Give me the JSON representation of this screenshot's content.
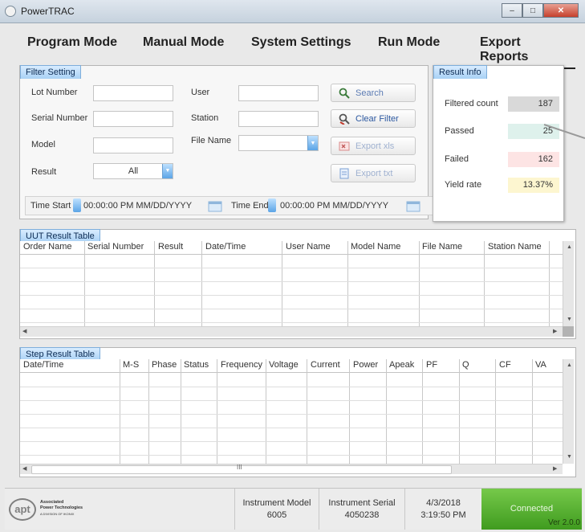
{
  "window": {
    "title": "PowerTRAC"
  },
  "nav": {
    "tabs": [
      "Program Mode",
      "Manual Mode",
      "System Settings",
      "Run Mode",
      "Export Reports"
    ],
    "active": "Export Reports"
  },
  "filter": {
    "title": "Filter Setting",
    "labels": {
      "lot_number": "Lot Number",
      "serial_number": "Serial Number",
      "model": "Model",
      "result": "Result",
      "user": "User",
      "station": "Station",
      "file_name": "File Name"
    },
    "values": {
      "lot_number": "",
      "serial_number": "",
      "model": "",
      "result": "All",
      "user": "",
      "station": "",
      "file_name": ""
    },
    "buttons": {
      "search": "Search",
      "clear_filter": "Clear Filter",
      "export_xls": "Export xls",
      "export_txt": "Export txt"
    },
    "time_start_label": "Time Start",
    "time_start_value": "00:00:00 PM MM/DD/YYYY",
    "time_end_label": "Time End",
    "time_end_value": "00:00:00 PM MM/DD/YYYY"
  },
  "result_info": {
    "title": "Result Info",
    "rows": [
      {
        "label": "Filtered count",
        "value": "187",
        "color": "#d9d9d9"
      },
      {
        "label": "Passed",
        "value": "25",
        "color": "#def1ec"
      },
      {
        "label": "Failed",
        "value": "162",
        "color": "#fde4e4"
      },
      {
        "label": "Yield rate",
        "value": "13.37%",
        "color": "#fdf6d0"
      }
    ]
  },
  "uut_table": {
    "title": "UUT Result Table",
    "columns": [
      "Order Name",
      "Serial Number",
      "Result",
      "Date/Time",
      "User Name",
      "Model Name",
      "File Name",
      "Station Name"
    ]
  },
  "step_table": {
    "title": "Step Result Table",
    "columns": [
      "Date/Time",
      "M-S",
      "Phase",
      "Status",
      "Frequency",
      "Voltage",
      "Current",
      "Power",
      "Apeak",
      "PF",
      "Q",
      "CF",
      "VA"
    ],
    "scroll_indicator": "III"
  },
  "status_bar": {
    "logo_text": "apt",
    "company_line1": "Associated",
    "company_line2": "Power Technologies",
    "company_line3": "A DIVISION OF IKONIX",
    "instrument_model_label": "Instrument Model",
    "instrument_model": "6005",
    "instrument_serial_label": "Instrument Serial",
    "instrument_serial": "4050238",
    "date": "4/3/2018",
    "time": "3:19:50 PM",
    "connection": "Connected",
    "version": "Ver 2.0.0"
  }
}
